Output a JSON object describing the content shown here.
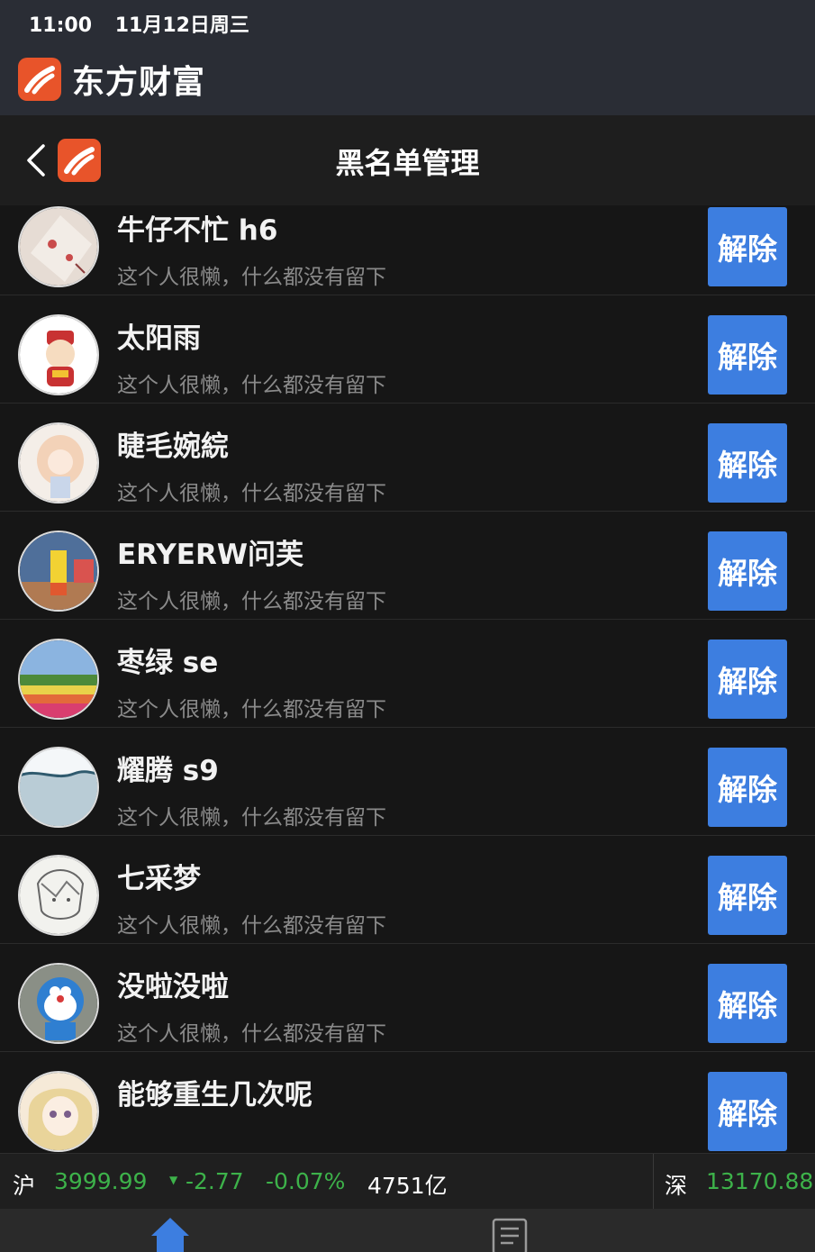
{
  "status_bar": {
    "time": "11:00",
    "date": "11月12日周三"
  },
  "app": {
    "name": "东方财富"
  },
  "nav": {
    "title": "黑名单管理"
  },
  "blacklist": {
    "button_label": "解除",
    "items": [
      {
        "name": "牛仔不忙 h6",
        "bio": "这个人很懒，什么都没有留下"
      },
      {
        "name": "太阳雨",
        "bio": "这个人很懒，什么都没有留下"
      },
      {
        "name": "睫毛婉綄",
        "bio": "这个人很懒，什么都没有留下"
      },
      {
        "name": "ERYERW问芙",
        "bio": "这个人很懒，什么都没有留下"
      },
      {
        "name": "枣绿 se",
        "bio": "这个人很懒，什么都没有留下"
      },
      {
        "name": "耀腾 s9",
        "bio": "这个人很懒，什么都没有留下"
      },
      {
        "name": "七采梦",
        "bio": "这个人很懒，什么都没有留下"
      },
      {
        "name": "没啦没啦",
        "bio": "这个人很懒，什么都没有留下"
      },
      {
        "name": "能够重生几次呢",
        "bio": ""
      }
    ]
  },
  "ticker": {
    "sh_label": "沪",
    "sh_index": "3999.99",
    "sh_change": "-2.77",
    "sh_pct": "-0.07%",
    "sh_volume": "4751亿",
    "sz_label": "深",
    "sz_index": "13170.88"
  },
  "tabbar": {
    "icons": [
      "home-icon",
      "news-icon"
    ]
  },
  "colors": {
    "accent": "#3d7ee0",
    "brand": "#e8542a",
    "down": "#3db24a",
    "background": "#161616"
  }
}
